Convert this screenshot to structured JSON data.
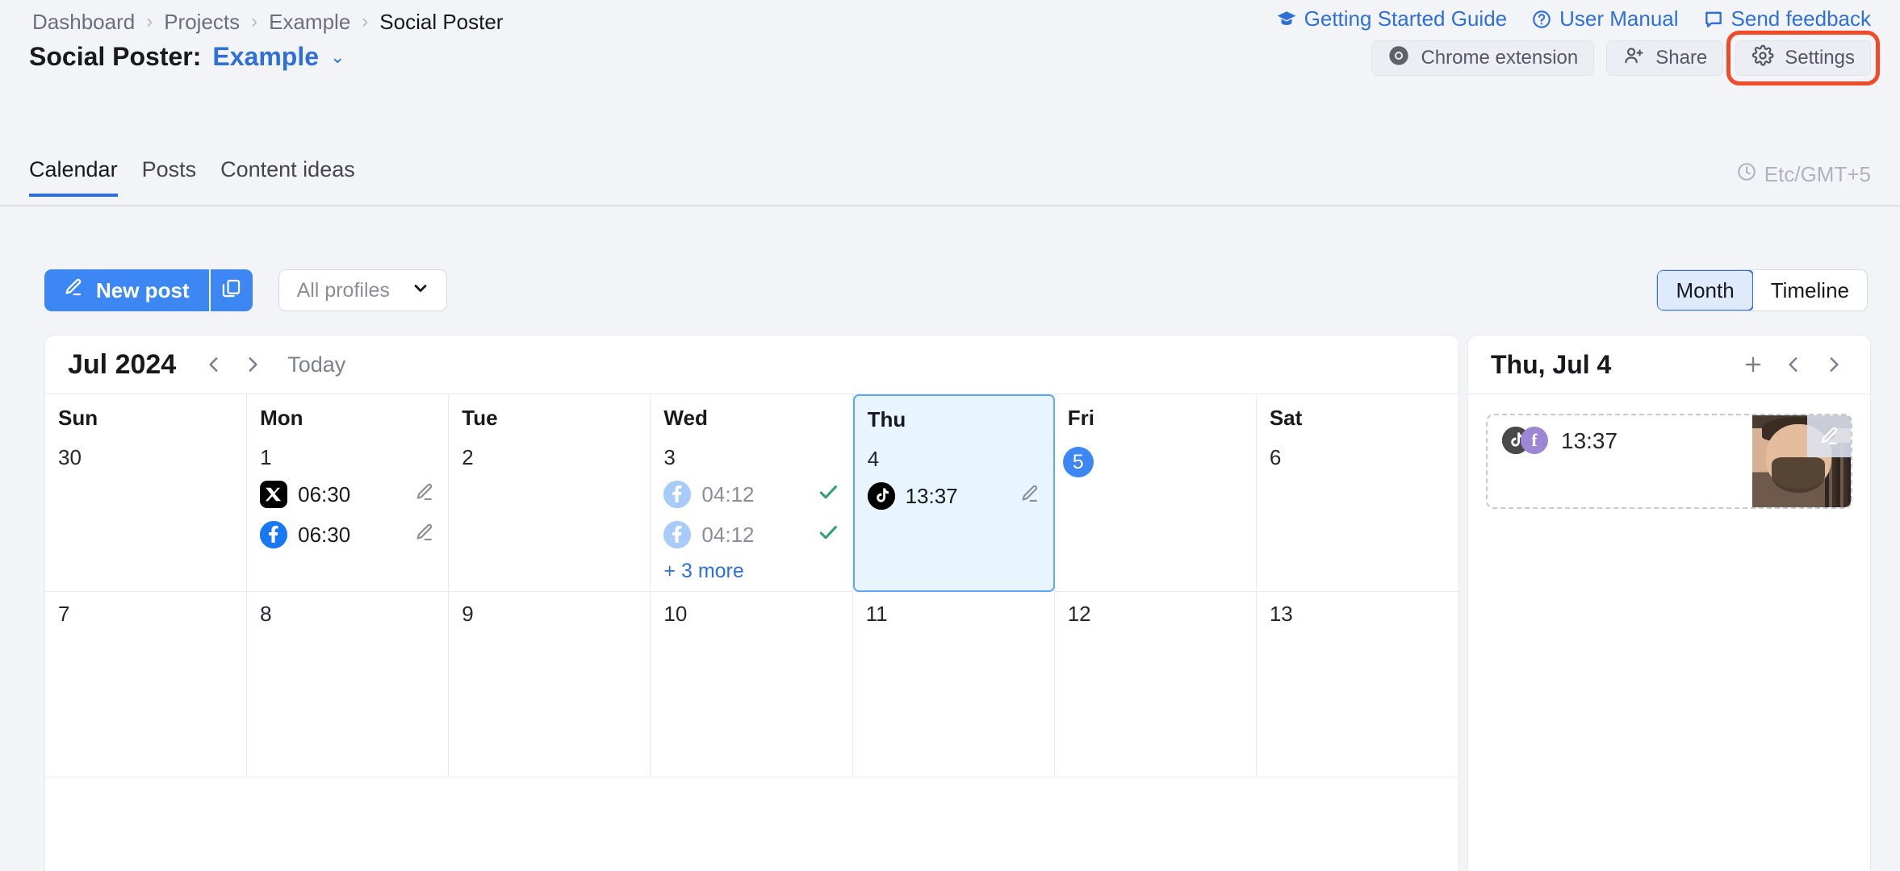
{
  "breadcrumb": {
    "items": [
      "Dashboard",
      "Projects",
      "Example",
      "Social Poster"
    ],
    "separator": "›"
  },
  "top_links": [
    {
      "label": "Getting Started Guide",
      "icon": "graduation-cap-icon"
    },
    {
      "label": "User Manual",
      "icon": "question-circle-icon"
    },
    {
      "label": "Send feedback",
      "icon": "message-icon"
    }
  ],
  "title": {
    "prefix": "Social Poster:",
    "project": "Example",
    "caret": "⌄"
  },
  "actions": {
    "chrome_extension": "Chrome extension",
    "share": "Share",
    "settings": "Settings",
    "highlight_color": "#f04b26"
  },
  "tabs": [
    {
      "label": "Calendar",
      "active": true
    },
    {
      "label": "Posts",
      "active": false
    },
    {
      "label": "Content ideas",
      "active": false
    }
  ],
  "timezone": "Etc/GMT+5",
  "toolbar": {
    "new_post": "New post",
    "duplicate_icon": "copy-icon",
    "profiles_value": "All profiles",
    "view_modes": [
      {
        "label": "Month",
        "active": true
      },
      {
        "label": "Timeline",
        "active": false
      }
    ]
  },
  "calendar": {
    "month_label": "Jul 2024",
    "today_label": "Today",
    "day_names": [
      "Sun",
      "Mon",
      "Tue",
      "Wed",
      "Thu",
      "Fri",
      "Sat"
    ],
    "weeks": [
      [
        {
          "day": "30",
          "muted": false,
          "selected": false,
          "badge": false,
          "events": [],
          "more": null
        },
        {
          "day": "1",
          "muted": false,
          "selected": false,
          "badge": false,
          "events": [
            {
              "platform": "x",
              "time": "06:30",
              "status": "draft"
            },
            {
              "platform": "facebook",
              "time": "06:30",
              "status": "draft"
            }
          ],
          "more": null
        },
        {
          "day": "2",
          "muted": false,
          "selected": false,
          "badge": false,
          "events": [],
          "more": null
        },
        {
          "day": "3",
          "muted": false,
          "selected": false,
          "badge": false,
          "events": [
            {
              "platform": "facebook-faded",
              "time": "04:12",
              "status": "sent"
            },
            {
              "platform": "facebook-faded",
              "time": "04:12",
              "status": "sent"
            }
          ],
          "more": "+ 3 more"
        },
        {
          "day": "4",
          "muted": false,
          "selected": true,
          "badge": false,
          "events": [
            {
              "platform": "tiktok",
              "time": "13:37",
              "status": "draft"
            }
          ],
          "more": null
        },
        {
          "day": "5",
          "muted": false,
          "selected": false,
          "badge": true,
          "events": [],
          "more": null
        },
        {
          "day": "6",
          "muted": false,
          "selected": false,
          "badge": false,
          "events": [],
          "more": null
        }
      ],
      [
        {
          "day": "7",
          "muted": false,
          "selected": false,
          "badge": false,
          "events": [],
          "more": null
        },
        {
          "day": "8",
          "muted": false,
          "selected": false,
          "badge": false,
          "events": [],
          "more": null
        },
        {
          "day": "9",
          "muted": false,
          "selected": false,
          "badge": false,
          "events": [],
          "more": null
        },
        {
          "day": "10",
          "muted": false,
          "selected": false,
          "badge": false,
          "events": [],
          "more": null
        },
        {
          "day": "11",
          "muted": false,
          "selected": false,
          "badge": false,
          "events": [],
          "more": null
        },
        {
          "day": "12",
          "muted": false,
          "selected": false,
          "badge": false,
          "events": [],
          "more": null
        },
        {
          "day": "13",
          "muted": false,
          "selected": false,
          "badge": false,
          "events": [],
          "more": null
        }
      ]
    ]
  },
  "side_panel": {
    "title": "Thu, Jul 4",
    "add_icon": "plus-icon",
    "prev_icon": "chevron-left-icon",
    "next_icon": "chevron-right-icon",
    "posts": [
      {
        "time": "13:37",
        "platforms": [
          "tiktok",
          "facebook-purple"
        ],
        "has_thumbnail": true
      }
    ]
  },
  "colors": {
    "accent": "#3d87f5",
    "link": "#2e6fd9",
    "page_bg": "#f3f4f8",
    "selected_day_bg": "#e9f5fe",
    "success": "#2fa06a"
  }
}
